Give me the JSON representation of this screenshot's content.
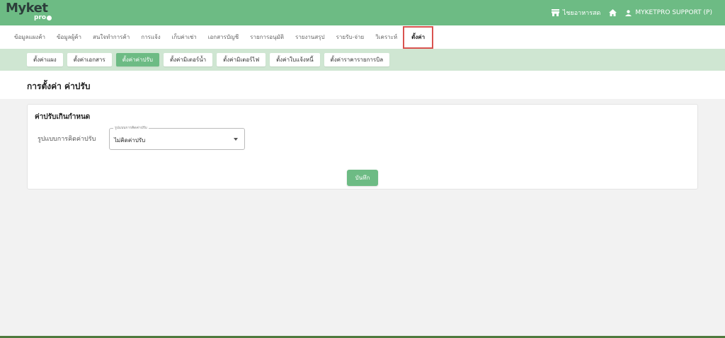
{
  "header": {
    "logo_main": "Myket",
    "logo_sub": "pro",
    "store_label": "ไชยอาหารสด",
    "user_label": "MYKETPRO SUPPORT (P)"
  },
  "main_nav": {
    "items": [
      {
        "label": "ข้อมูลแผงค้า"
      },
      {
        "label": "ข้อมูลผู้ค้า"
      },
      {
        "label": "สนใจทำการค้า"
      },
      {
        "label": "การแจ้ง"
      },
      {
        "label": "เก็บค่าเช่า"
      },
      {
        "label": "เอกสารบัญชี"
      },
      {
        "label": "รายการอนุมัติ"
      },
      {
        "label": "รายงานสรุป"
      },
      {
        "label": "รายรับ-จ่าย"
      },
      {
        "label": "วิเคราะห์"
      },
      {
        "label": "ตั้งค่า"
      }
    ],
    "active_index": 10
  },
  "sub_nav": {
    "items": [
      {
        "label": "ตั้งค่าแผง"
      },
      {
        "label": "ตั้งค่าเอกสาร"
      },
      {
        "label": "ตั้งค่าค่าปรับ"
      },
      {
        "label": "ตั้งค่ามิเตอร์น้ำ"
      },
      {
        "label": "ตั้งค่ามิเตอร์ไฟ"
      },
      {
        "label": "ตั้งค่าใบแจ้งหนี้"
      },
      {
        "label": "ตั้งค่าราคารายการบิล"
      }
    ],
    "active_index": 2
  },
  "page": {
    "title": "การตั้งค่า ค่าปรับ"
  },
  "card": {
    "title": "ค่าปรับเกินกำหนด",
    "field_label": "รูปแบบการคิดค่าปรับ",
    "select_legend": "รูปแบบการคิดค่าปรับ",
    "select_value": "ไม่คิดค่าปรับ",
    "save_label": "บันทึก"
  },
  "colors": {
    "brand_green": "#6dbb84",
    "subnav_bg": "#cfe6d2",
    "highlight_red": "#d9534f"
  }
}
